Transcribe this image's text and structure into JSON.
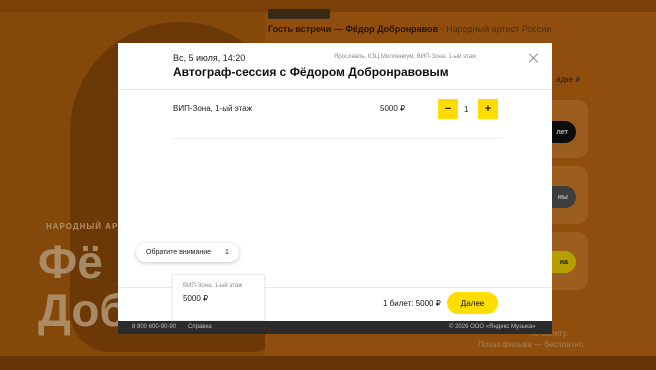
{
  "background": {
    "info_bold": "Гость встречи — Фёдор Добронравов",
    "info_rest": " · Народный артист России",
    "side_text": "адке и",
    "artist_small": "НАРОДНЫЙ АР",
    "artist_big": "Фё\nДоб",
    "pill_1": "лет",
    "pill_2": "ны",
    "pill_3": "на",
    "footnote_1": "по билету.",
    "footnote_2": "Показ фильма — бесплатно."
  },
  "modal": {
    "date": "Вс, 5 июля, 14:20",
    "venue": "Ярославль, КЗЦ Миллениум, ВИП-Зона, 1-ый этаж",
    "title": "Автограф-сессия с Фёдором Добронравовым",
    "ticket_row": {
      "name": "ВИП-Зона, 1-ый этаж",
      "price": "5000 ₽",
      "minus": "−",
      "quantity": "1",
      "plus": "+"
    },
    "attention": {
      "label": "Обратите внимание",
      "count": "1"
    },
    "selected_ticket": {
      "zone": "ВИП-Зона, 1-ый этаж",
      "price": "5000 ₽"
    },
    "total": "1 билет: 5000 ₽",
    "next_button": "Далее"
  },
  "footer": {
    "phone": "8 800 600-90-90",
    "help": "Справка",
    "copyright": "© 2026 ООО «Яндекс Музыка»"
  },
  "colors": {
    "accent": "#ffdd00",
    "background_orange": "#c66c12",
    "footer_dark": "#2b2b2b"
  }
}
